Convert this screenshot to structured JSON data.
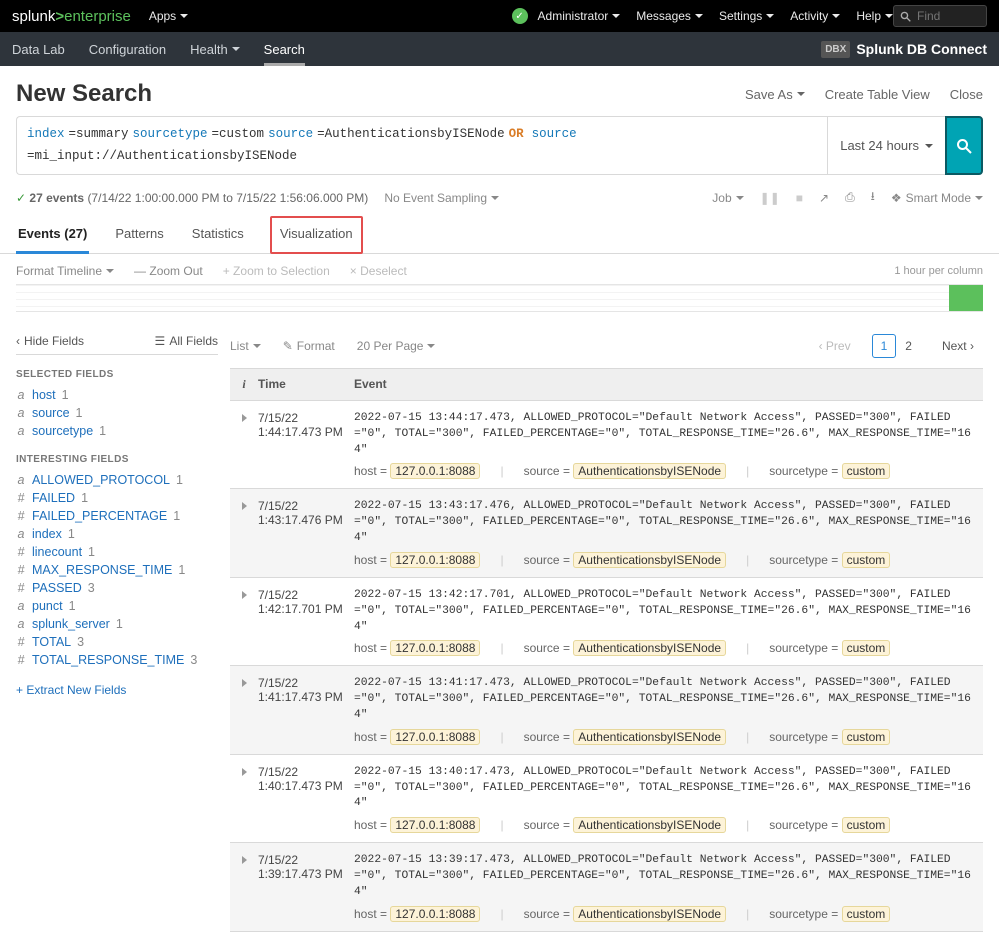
{
  "topbar": {
    "logo_pre": "splunk",
    "logo_post": "enterprise",
    "apps_label": "Apps",
    "right_items": [
      "Administrator",
      "Messages",
      "Settings",
      "Activity",
      "Help"
    ],
    "find_placeholder": "Find"
  },
  "navbar": {
    "items": [
      "Data Lab",
      "Configuration",
      "Health",
      "Search"
    ],
    "active_index": 3,
    "health_has_caret": true,
    "dbx_badge": "DBX",
    "app_title": "Splunk DB Connect"
  },
  "page": {
    "title": "New Search",
    "saveas": "Save As",
    "create_table": "Create Table View",
    "close": "Close"
  },
  "search": {
    "tokens": [
      {
        "t": "index",
        "cls": "kw-cmd"
      },
      {
        "t": "=summary ",
        "cls": ""
      },
      {
        "t": "sourcetype",
        "cls": "kw-cmd"
      },
      {
        "t": "=custom ",
        "cls": ""
      },
      {
        "t": "source",
        "cls": "kw-cmd"
      },
      {
        "t": "=AuthenticationsbyISENode ",
        "cls": ""
      },
      {
        "t": "OR",
        "cls": "kw-op"
      },
      {
        "t": " ",
        "cls": ""
      },
      {
        "t": "source",
        "cls": "kw-cmd"
      },
      {
        "t": "=mi_input://AuthenticationsbyISENode",
        "cls": ""
      }
    ],
    "time_label": "Last 24 hours"
  },
  "status": {
    "count": "27 events",
    "range": "(7/14/22 1:00:00.000 PM to 7/15/22 1:56:06.000 PM)",
    "sampling": "No Event Sampling",
    "job": "Job",
    "smart": "Smart Mode"
  },
  "tabs": {
    "events": "Events (27)",
    "patterns": "Patterns",
    "statistics": "Statistics",
    "visualization": "Visualization"
  },
  "timeline": {
    "format_timeline": "Format Timeline",
    "zoom_out": "— Zoom Out",
    "zoom_sel": "+ Zoom to Selection",
    "deselect": "× Deselect",
    "scale": "1 hour per column"
  },
  "listctrl": {
    "list": "List",
    "format": "Format",
    "perpage": "20 Per Page",
    "prev": "Prev",
    "pages": [
      "1",
      "2"
    ],
    "next": "Next"
  },
  "sidebar": {
    "hide": "Hide Fields",
    "all": "All Fields",
    "selected_title": "SELECTED FIELDS",
    "selected": [
      {
        "type": "a",
        "name": "host",
        "count": "1"
      },
      {
        "type": "a",
        "name": "source",
        "count": "1"
      },
      {
        "type": "a",
        "name": "sourcetype",
        "count": "1"
      }
    ],
    "interesting_title": "INTERESTING FIELDS",
    "interesting": [
      {
        "type": "a",
        "name": "ALLOWED_PROTOCOL",
        "count": "1"
      },
      {
        "type": "#",
        "name": "FAILED",
        "count": "1"
      },
      {
        "type": "#",
        "name": "FAILED_PERCENTAGE",
        "count": "1"
      },
      {
        "type": "a",
        "name": "index",
        "count": "1"
      },
      {
        "type": "#",
        "name": "linecount",
        "count": "1"
      },
      {
        "type": "#",
        "name": "MAX_RESPONSE_TIME",
        "count": "1"
      },
      {
        "type": "#",
        "name": "PASSED",
        "count": "3"
      },
      {
        "type": "a",
        "name": "punct",
        "count": "1"
      },
      {
        "type": "a",
        "name": "splunk_server",
        "count": "1"
      },
      {
        "type": "#",
        "name": "TOTAL",
        "count": "3"
      },
      {
        "type": "#",
        "name": "TOTAL_RESPONSE_TIME",
        "count": "3"
      }
    ],
    "extract": "+ Extract New Fields"
  },
  "table": {
    "h_time": "Time",
    "h_event": "Event",
    "events": [
      {
        "date": "7/15/22",
        "time": "1:44:17.473 PM",
        "raw": "2022-07-15 13:44:17.473, ALLOWED_PROTOCOL=\"Default Network Access\", PASSED=\"300\", FAILED=\"0\", TOTAL=\"300\", FAILED_PERCENTAGE=\"0\", TOTAL_RESPONSE_TIME=\"26.6\", MAX_RESPONSE_TIME=\"164\"",
        "host": "127.0.0.1:8088",
        "source": "AuthenticationsbyISENode",
        "sourcetype": "custom"
      },
      {
        "date": "7/15/22",
        "time": "1:43:17.476 PM",
        "raw": "2022-07-15 13:43:17.476, ALLOWED_PROTOCOL=\"Default Network Access\", PASSED=\"300\", FAILED=\"0\", TOTAL=\"300\", FAILED_PERCENTAGE=\"0\", TOTAL_RESPONSE_TIME=\"26.6\", MAX_RESPONSE_TIME=\"164\"",
        "host": "127.0.0.1:8088",
        "source": "AuthenticationsbyISENode",
        "sourcetype": "custom"
      },
      {
        "date": "7/15/22",
        "time": "1:42:17.701 PM",
        "raw": "2022-07-15 13:42:17.701, ALLOWED_PROTOCOL=\"Default Network Access\", PASSED=\"300\", FAILED=\"0\", TOTAL=\"300\", FAILED_PERCENTAGE=\"0\", TOTAL_RESPONSE_TIME=\"26.6\", MAX_RESPONSE_TIME=\"164\"",
        "host": "127.0.0.1:8088",
        "source": "AuthenticationsbyISENode",
        "sourcetype": "custom"
      },
      {
        "date": "7/15/22",
        "time": "1:41:17.473 PM",
        "raw": "2022-07-15 13:41:17.473, ALLOWED_PROTOCOL=\"Default Network Access\", PASSED=\"300\", FAILED=\"0\", TOTAL=\"300\", FAILED_PERCENTAGE=\"0\", TOTAL_RESPONSE_TIME=\"26.6\", MAX_RESPONSE_TIME=\"164\"",
        "host": "127.0.0.1:8088",
        "source": "AuthenticationsbyISENode",
        "sourcetype": "custom"
      },
      {
        "date": "7/15/22",
        "time": "1:40:17.473 PM",
        "raw": "2022-07-15 13:40:17.473, ALLOWED_PROTOCOL=\"Default Network Access\", PASSED=\"300\", FAILED=\"0\", TOTAL=\"300\", FAILED_PERCENTAGE=\"0\", TOTAL_RESPONSE_TIME=\"26.6\", MAX_RESPONSE_TIME=\"164\"",
        "host": "127.0.0.1:8088",
        "source": "AuthenticationsbyISENode",
        "sourcetype": "custom"
      },
      {
        "date": "7/15/22",
        "time": "1:39:17.473 PM",
        "raw": "2022-07-15 13:39:17.473, ALLOWED_PROTOCOL=\"Default Network Access\", PASSED=\"300\", FAILED=\"0\", TOTAL=\"300\", FAILED_PERCENTAGE=\"0\", TOTAL_RESPONSE_TIME=\"26.6\", MAX_RESPONSE_TIME=\"164\"",
        "host": "127.0.0.1:8088",
        "source": "AuthenticationsbyISENode",
        "sourcetype": "custom"
      }
    ],
    "meta_labels": {
      "host": "host",
      "source": "source",
      "sourcetype": "sourcetype"
    }
  }
}
